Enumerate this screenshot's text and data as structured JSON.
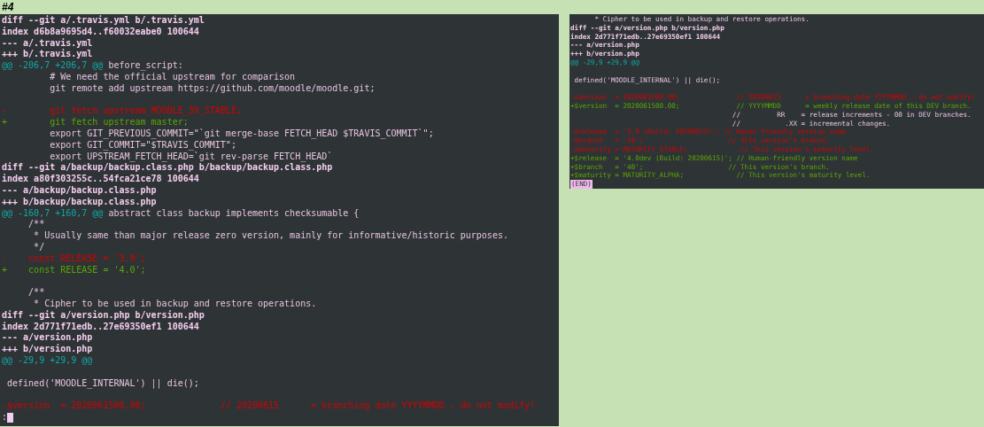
{
  "header": "#4",
  "panes": [
    {
      "lines": [
        {
          "kind": "meta",
          "text": "diff --git a/.travis.yml b/.travis.yml"
        },
        {
          "kind": "meta",
          "text": "index d6b8a9695d4..f60032eabe0 100644"
        },
        {
          "kind": "meta",
          "text": "--- a/.travis.yml"
        },
        {
          "kind": "meta",
          "text": "+++ b/.travis.yml"
        },
        {
          "kind": "hunk",
          "range": "@@ -206,7 +206,7 @@",
          "text": " before_script:"
        },
        {
          "kind": "context",
          "text": "         # We need the official upstream for comparison"
        },
        {
          "kind": "context",
          "text": "         git remote add upstream https://github.com/moodle/moodle.git;"
        },
        {
          "kind": "blank"
        },
        {
          "kind": "del",
          "text": "-        git fetch upstream MOODLE_39_STABLE;"
        },
        {
          "kind": "add",
          "text": "+        git fetch upstream master;"
        },
        {
          "kind": "context",
          "text": "         export GIT_PREVIOUS_COMMIT=\"`git merge-base FETCH_HEAD $TRAVIS_COMMIT`\";"
        },
        {
          "kind": "context",
          "text": "         export GIT_COMMIT=\"$TRAVIS_COMMIT\";"
        },
        {
          "kind": "context",
          "text": "         export UPSTREAM_FETCH_HEAD=`git rev-parse FETCH_HEAD`"
        },
        {
          "kind": "meta",
          "text": "diff --git a/backup/backup.class.php b/backup/backup.class.php"
        },
        {
          "kind": "meta",
          "text": "index a80f303255c..54fca21ce78 100644"
        },
        {
          "kind": "meta",
          "text": "--- a/backup/backup.class.php"
        },
        {
          "kind": "meta",
          "text": "+++ b/backup/backup.class.php"
        },
        {
          "kind": "hunk",
          "range": "@@ -160,7 +160,7 @@",
          "text": " abstract class backup implements checksumable {"
        },
        {
          "kind": "context",
          "text": "     /**"
        },
        {
          "kind": "context",
          "text": "      * Usually same than major release zero version, mainly for informative/historic purposes."
        },
        {
          "kind": "context",
          "text": "      */"
        },
        {
          "kind": "del",
          "text": "-    const RELEASE = '3.9';"
        },
        {
          "kind": "add",
          "text": "+    const RELEASE = '4.0';"
        },
        {
          "kind": "blank"
        },
        {
          "kind": "context",
          "text": "     /**"
        },
        {
          "kind": "context",
          "text": "      * Cipher to be used in backup and restore operations."
        },
        {
          "kind": "meta",
          "text": "diff --git a/version.php b/version.php"
        },
        {
          "kind": "meta",
          "text": "index 2d771f71edb..27e69350ef1 100644"
        },
        {
          "kind": "meta",
          "text": "--- a/version.php"
        },
        {
          "kind": "meta",
          "text": "+++ b/version.php"
        },
        {
          "kind": "hunk",
          "range": "@@ -29,9 +29,9 @@"
        },
        {
          "kind": "blank"
        },
        {
          "kind": "context",
          "text": " defined('MOODLE_INTERNAL') || die();"
        },
        {
          "kind": "blank"
        },
        {
          "kind": "del",
          "text": "-$version  = 2020061500.00;              // 20200615      = branching date YYYYMMDD - do not modify!"
        }
      ],
      "prompt": {
        "kind": "cursor",
        "text": ":"
      }
    },
    {
      "lines": [
        {
          "kind": "context",
          "text": "      * Cipher to be used in backup and restore operations."
        },
        {
          "kind": "meta",
          "text": "diff --git a/version.php b/version.php"
        },
        {
          "kind": "meta",
          "text": "index 2d771f71edb..27e69350ef1 100644"
        },
        {
          "kind": "meta",
          "text": "--- a/version.php"
        },
        {
          "kind": "meta",
          "text": "+++ b/version.php"
        },
        {
          "kind": "hunk",
          "range": "@@ -29,9 +29,9 @@"
        },
        {
          "kind": "blank"
        },
        {
          "kind": "context",
          "text": " defined('MOODLE_INTERNAL') || die();"
        },
        {
          "kind": "blank"
        },
        {
          "kind": "del",
          "text": "-$version  = 2020061500.00;              // 20200615      = branching date YYYYMMDD - do not modify!"
        },
        {
          "kind": "add",
          "text": "+$version  = 2020061500.00;              // YYYYMMDD      = weekly release date of this DEV branch."
        },
        {
          "kind": "context",
          "text": "                                        //         RR    = release increments - 00 in DEV branches."
        },
        {
          "kind": "context",
          "text": "                                        //           .XX = incremental changes."
        },
        {
          "kind": "del",
          "text": "-$release  = '3.9 (Build: 20200615)'; // Human-friendly version name"
        },
        {
          "kind": "del",
          "text": "-$branch   = '39';                     // This version's branch."
        },
        {
          "kind": "del",
          "text": "-$maturity = MATURITY_STABLE;             // This version's maturity level."
        },
        {
          "kind": "add",
          "text": "+$release  = '4.0dev (Build: 20200615)'; // Human-friendly version name"
        },
        {
          "kind": "add",
          "text": "+$branch   = '40';                     // This version's branch."
        },
        {
          "kind": "add",
          "text": "+$maturity = MATURITY_ALPHA;             // This version's maturity level."
        }
      ],
      "prompt": {
        "kind": "end",
        "text": "(END)"
      }
    }
  ]
}
